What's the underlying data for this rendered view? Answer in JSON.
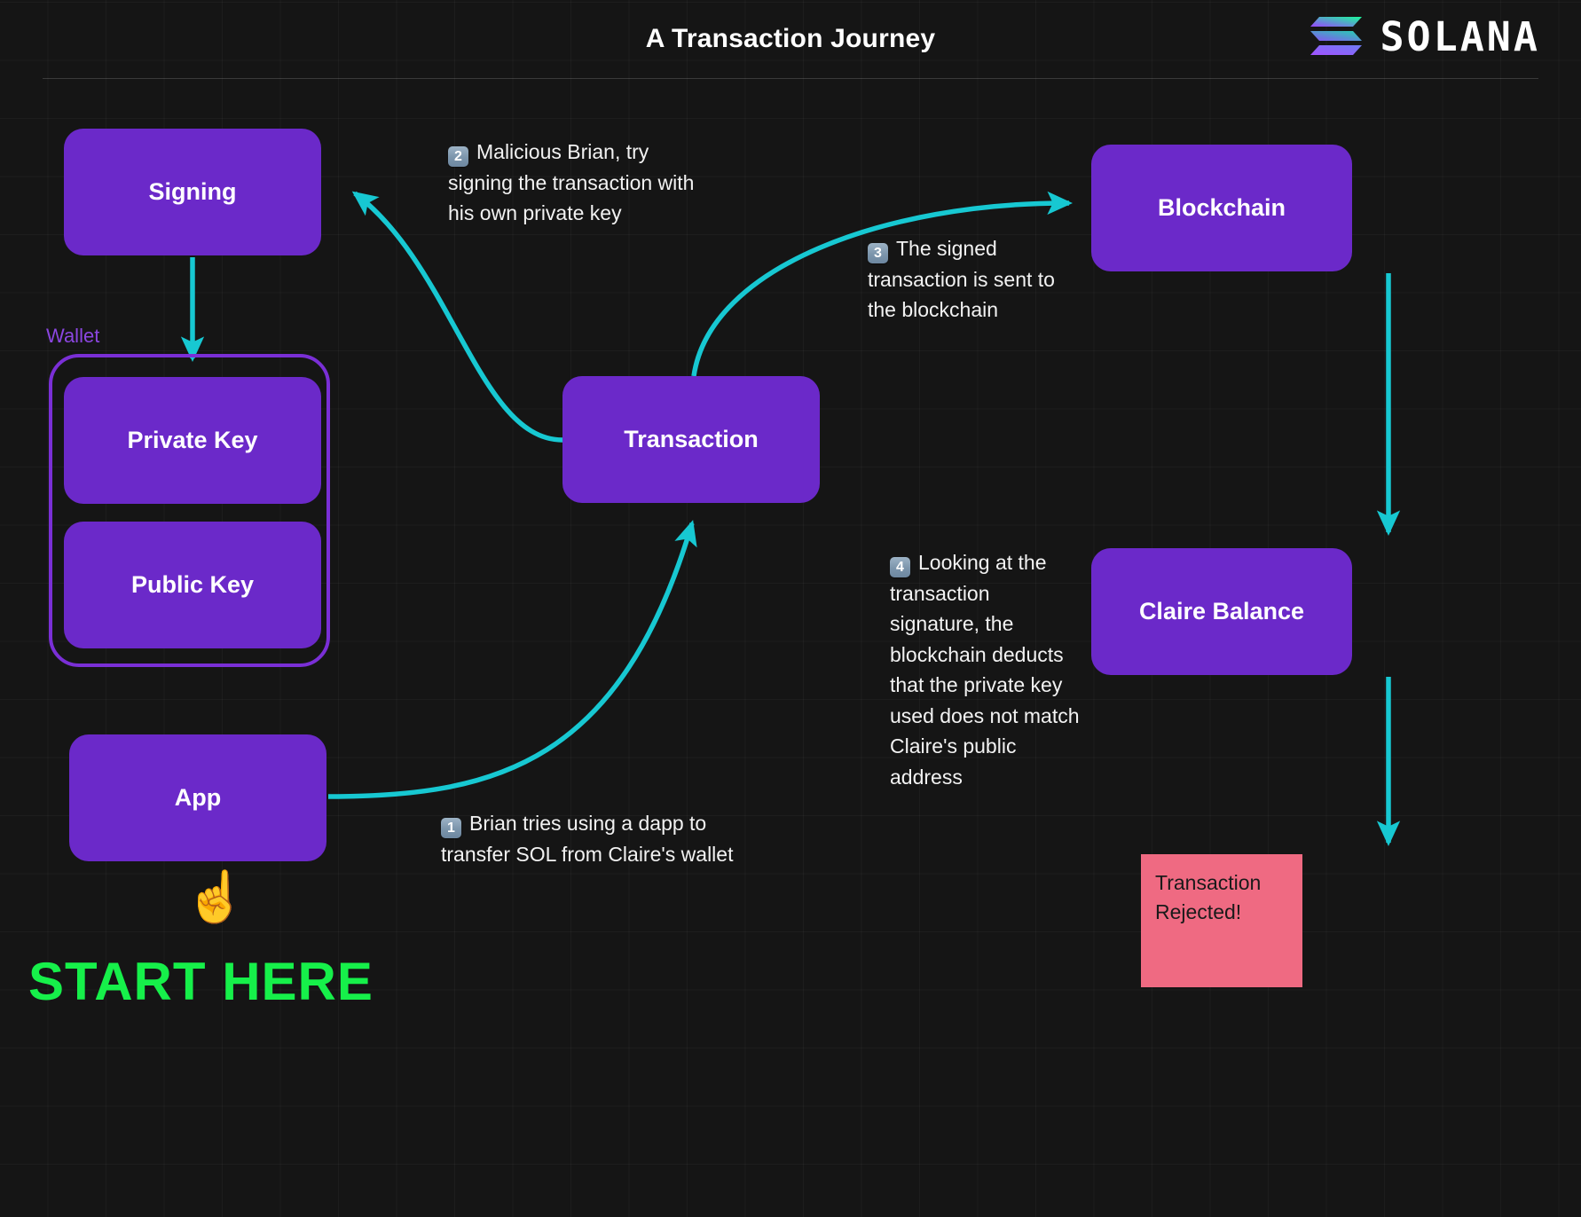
{
  "header": {
    "title": "A Transaction Journey",
    "logo_wordmark": "SOLANA",
    "logo_icon": "solana-mark"
  },
  "nodes": {
    "signing": "Signing",
    "private_key": "Private Key",
    "public_key": "Public Key",
    "app": "App",
    "transaction": "Transaction",
    "blockchain": "Blockchain",
    "claire_balance": "Claire Balance",
    "wallet_group_label": "Wallet",
    "rejected_note": "Transaction Rejected!"
  },
  "callouts": [
    {
      "number": "1",
      "text": "Brian tries using a dapp to transfer SOL from Claire's wallet"
    },
    {
      "number": "2",
      "text": "Malicious Brian, try signing the transaction with his own private key"
    },
    {
      "number": "3",
      "text": "The signed transaction is sent to the blockchain"
    },
    {
      "number": "4",
      "text": "Looking at the transaction signature, the blockchain deducts that the private key used does not match Claire's public address"
    }
  ],
  "start": {
    "pointer_icon": "☝",
    "label": "START HERE"
  },
  "colors": {
    "background": "#151515",
    "node_purple": "#6b29c9",
    "wallet_border": "#7a2fd6",
    "arrow_cyan": "#17c8d2",
    "rejected_pink": "#ef6a82",
    "start_green": "#16f04a",
    "title_white": "#ffffff"
  }
}
